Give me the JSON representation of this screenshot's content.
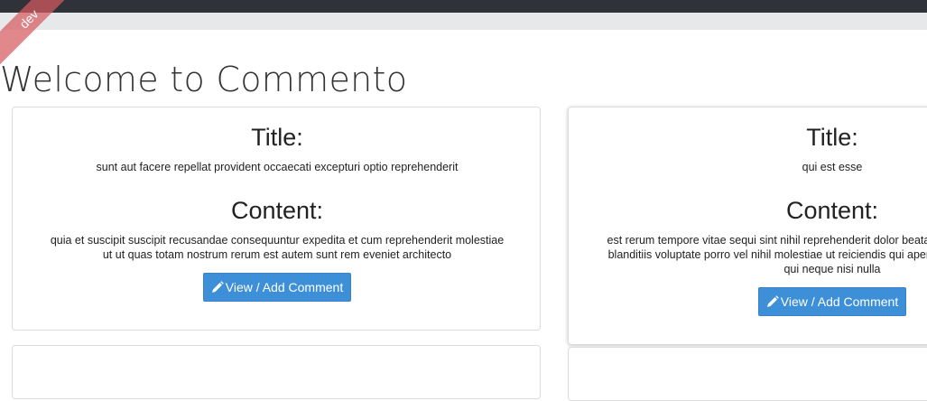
{
  "env_badge": "dev",
  "page": {
    "title": "Welcome to Commento"
  },
  "posts": [
    {
      "title_heading": "Title:",
      "title": "sunt aut facere repellat provident occaecati excepturi optio reprehenderit",
      "content_heading": "Content:",
      "content": "quia et suscipit suscipit recusandae consequuntur expedita et cum reprehenderit molestiae ut ut quas totam nostrum rerum est autem sunt rem eveniet architecto",
      "button_label": "View / Add Comment"
    },
    {
      "title_heading": "Title:",
      "title": "qui est esse",
      "content_heading": "Content:",
      "content": "est rerum tempore vitae sequi sint nihil reprehenderit dolor beatae ea dolores neque fugiat blanditiis voluptate porro vel nihil molestiae ut reiciendis qui aperiam non debitis possimus qui neque nisi nulla",
      "button_label": "View / Add Comment"
    }
  ],
  "icons": {
    "button_icon": "pencil-icon"
  }
}
